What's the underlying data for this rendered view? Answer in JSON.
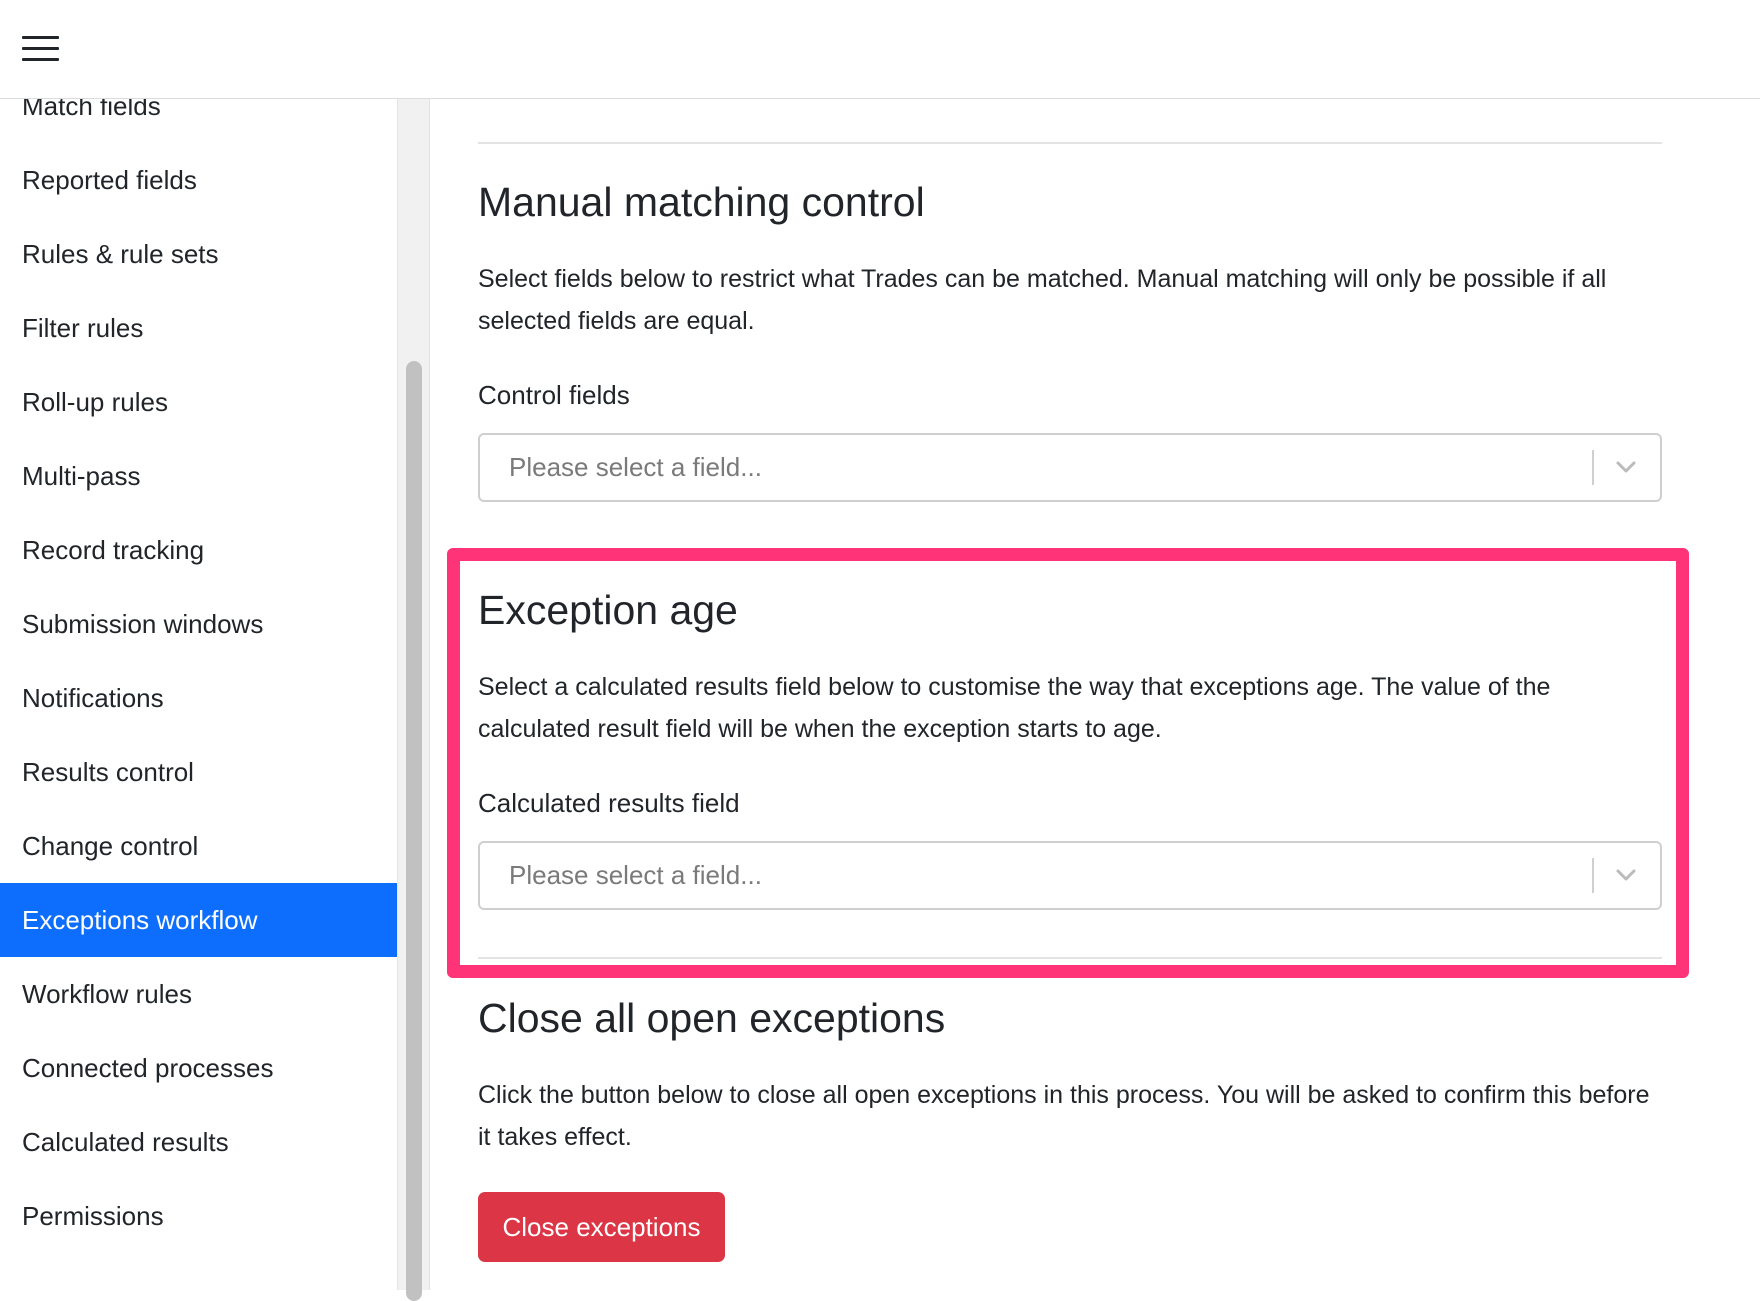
{
  "header": {
    "menu_icon": "hamburger-menu-icon"
  },
  "sidebar": {
    "items": [
      {
        "label": "Match fields",
        "active": false
      },
      {
        "label": "Reported fields",
        "active": false
      },
      {
        "label": "Rules & rule sets",
        "active": false
      },
      {
        "label": "Filter rules",
        "active": false
      },
      {
        "label": "Roll-up rules",
        "active": false
      },
      {
        "label": "Multi-pass",
        "active": false
      },
      {
        "label": "Record tracking",
        "active": false
      },
      {
        "label": "Submission windows",
        "active": false
      },
      {
        "label": "Notifications",
        "active": false
      },
      {
        "label": "Results control",
        "active": false
      },
      {
        "label": "Change control",
        "active": false
      },
      {
        "label": "Exceptions workflow",
        "active": true
      },
      {
        "label": "Workflow rules",
        "active": false
      },
      {
        "label": "Connected processes",
        "active": false
      },
      {
        "label": "Calculated results",
        "active": false
      },
      {
        "label": "Permissions",
        "active": false
      }
    ]
  },
  "sections": {
    "manual_matching": {
      "title": "Manual matching control",
      "description": "Select fields below to restrict what Trades can be matched. Manual matching will only be possible if all selected fields are equal.",
      "field_label": "Control fields",
      "placeholder": "Please select a field..."
    },
    "exception_age": {
      "title": "Exception age",
      "description": "Select a calculated results field below to customise the way that exceptions age. The value of the calculated result field will be when the exception starts to age.",
      "field_label": "Calculated results field",
      "placeholder": "Please select a field..."
    },
    "close_exceptions": {
      "title": "Close all open exceptions",
      "description": "Click the button below to close all open exceptions in this process. You will be asked to confirm this before it takes effect.",
      "button_label": "Close exceptions"
    }
  },
  "colors": {
    "active_item": "#0d6efd",
    "highlight": "#ff3377",
    "danger_button": "#dc3545"
  }
}
